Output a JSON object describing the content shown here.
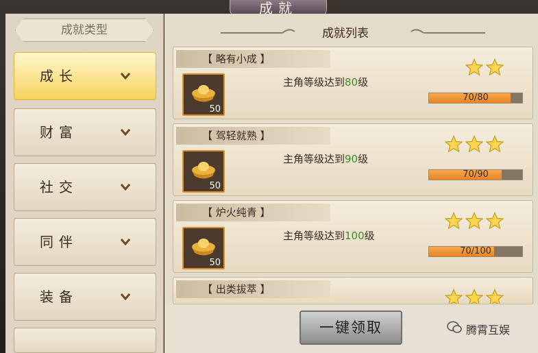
{
  "window": {
    "title": "成就"
  },
  "sidebar": {
    "header": "成就类型",
    "items": [
      {
        "label": "成长",
        "active": true
      },
      {
        "label": "财富",
        "active": false
      },
      {
        "label": "社交",
        "active": false
      },
      {
        "label": "同伴",
        "active": false
      },
      {
        "label": "装备",
        "active": false
      }
    ]
  },
  "main": {
    "title": "成就列表",
    "achievements": [
      {
        "name": "【 略有小成 】",
        "desc_prefix": "主角等级达到",
        "target": "80",
        "desc_suffix": "级",
        "reward_count": "50",
        "stars": 2,
        "progress_text": "70/80",
        "progress": 0.875
      },
      {
        "name": "【 驾轻就熟 】",
        "desc_prefix": "主角等级达到",
        "target": "90",
        "desc_suffix": "级",
        "reward_count": "50",
        "stars": 3,
        "progress_text": "70/90",
        "progress": 0.778
      },
      {
        "name": "【 炉火纯青 】",
        "desc_prefix": "主角等级达到",
        "target": "100",
        "desc_suffix": "级",
        "reward_count": "50",
        "stars": 3,
        "progress_text": "70/100",
        "progress": 0.7
      },
      {
        "name": "【 出类拔萃 】",
        "stars": 3
      }
    ],
    "claim_all_label": "一键领取"
  },
  "watermark": "腾霄互娱",
  "colors": {
    "accent": "#f6d25c",
    "progress": "#e98324",
    "target_number": "#3f8a29"
  }
}
